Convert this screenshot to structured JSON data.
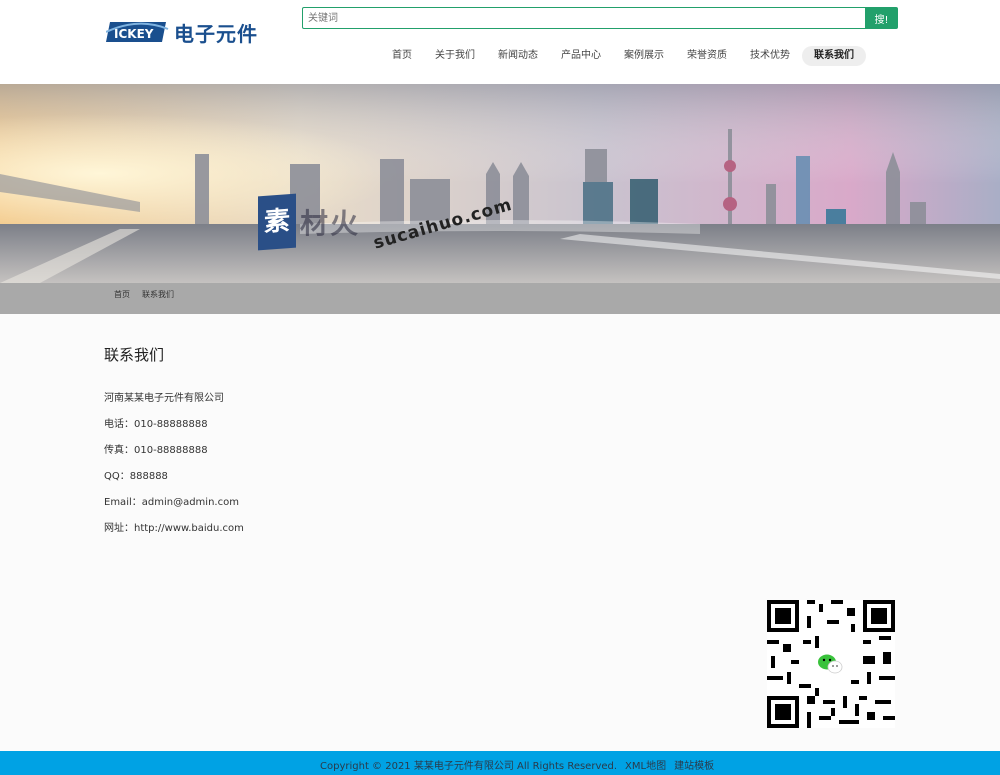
{
  "header": {
    "logo_badge": "ICKEY",
    "logo_text": "电子元件",
    "search": {
      "placeholder": "关键词",
      "button_label": "搜!"
    },
    "nav": [
      {
        "label": "首页"
      },
      {
        "label": "关于我们"
      },
      {
        "label": "新闻动态"
      },
      {
        "label": "产品中心"
      },
      {
        "label": "案例展示"
      },
      {
        "label": "荣誉资质"
      },
      {
        "label": "技术优势"
      },
      {
        "label": "联系我们",
        "active": true
      }
    ]
  },
  "banner": {
    "watermark_block": "素",
    "watermark_word": "材火",
    "watermark_url": "sucaihuo.com"
  },
  "breadcrumb": [
    "首页",
    "联系我们"
  ],
  "contact": {
    "title": "联系我们",
    "company": "河南某某电子元件有限公司",
    "phone": "电话：010-88888888",
    "fax": "传真：010-88888888",
    "qq": "QQ：888888",
    "email": "Email：admin@admin.com",
    "website": "网址：http://www.baidu.com"
  },
  "footer": {
    "copyright": "Copyright © 2021 某某电子元件有限公司 All Rights Reserved.",
    "sitemap": "XML地图",
    "template": "建站模板"
  },
  "colors": {
    "accent": "#22a06b",
    "footer": "#00a2e4",
    "brand": "#1a4f8e"
  }
}
